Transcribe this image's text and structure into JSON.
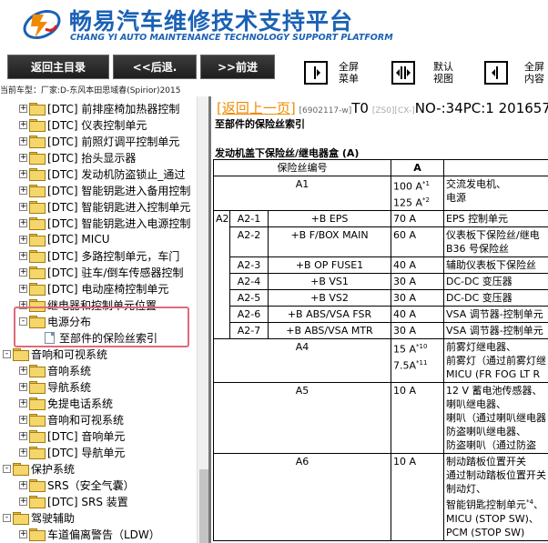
{
  "header": {
    "title": "畅易汽车维修技术支持平台",
    "subtitle": "CHANG YI AUTO MAINTENANCE TECHNOLOGY SUPPORT PLATFORM",
    "logo_color": "#1a61b5"
  },
  "toolbar": {
    "home": "返回主目录",
    "back": "<<后退.",
    "forward": ">>前进",
    "fullscreen_menu": [
      "全屏",
      "菜单"
    ],
    "default_view": [
      "默认",
      "视图"
    ],
    "fullscreen_content": [
      "全屏",
      "内容"
    ]
  },
  "path": "当前车型：厂家:D-东风本田思域春(Spirior)2015",
  "tree": [
    {
      "label": "[DTC] 前排座椅加热器控制",
      "indent": 1,
      "exp": "+",
      "type": "folder"
    },
    {
      "label": "[DTC] 仪表控制单元",
      "indent": 1,
      "exp": "+",
      "type": "folder"
    },
    {
      "label": "[DTC] 前照灯调平控制单元",
      "indent": 1,
      "exp": "+",
      "type": "folder"
    },
    {
      "label": "[DTC] 抬头显示器",
      "indent": 1,
      "exp": "+",
      "type": "folder"
    },
    {
      "label": "[DTC] 发动机防盗锁止_通过",
      "indent": 1,
      "exp": "+",
      "type": "folder"
    },
    {
      "label": "[DTC] 智能钥匙进入备用控制",
      "indent": 1,
      "exp": "+",
      "type": "folder"
    },
    {
      "label": "[DTC] 智能钥匙进入控制单元",
      "indent": 1,
      "exp": "+",
      "type": "folder"
    },
    {
      "label": "[DTC] 智能钥匙进入电源控制",
      "indent": 1,
      "exp": "+",
      "type": "folder"
    },
    {
      "label": "[DTC] MICU",
      "indent": 1,
      "exp": "+",
      "type": "folder"
    },
    {
      "label": "[DTC] 多路控制单元，车门",
      "indent": 1,
      "exp": "+",
      "type": "folder"
    },
    {
      "label": "[DTC] 驻车/倒车传感器控制",
      "indent": 1,
      "exp": "+",
      "type": "folder"
    },
    {
      "label": "[DTC] 电动座椅控制单元",
      "indent": 1,
      "exp": "+",
      "type": "folder"
    },
    {
      "label": "继电器和控制单元位置",
      "indent": 1,
      "exp": "+",
      "type": "folder"
    },
    {
      "label": "电源分布",
      "indent": 1,
      "exp": "-",
      "type": "folder"
    },
    {
      "label": "至部件的保险丝索引",
      "indent": 2,
      "exp": "",
      "type": "doc"
    },
    {
      "label": "音响和可视系统",
      "indent": 0,
      "exp": "-",
      "type": "folder"
    },
    {
      "label": "音响系统",
      "indent": 1,
      "exp": "+",
      "type": "folder"
    },
    {
      "label": "导航系统",
      "indent": 1,
      "exp": "+",
      "type": "folder"
    },
    {
      "label": "免提电话系统",
      "indent": 1,
      "exp": "+",
      "type": "folder"
    },
    {
      "label": "音响和可视系统",
      "indent": 1,
      "exp": "+",
      "type": "folder"
    },
    {
      "label": "[DTC] 音响单元",
      "indent": 1,
      "exp": "+",
      "type": "folder"
    },
    {
      "label": "[DTC] 导航单元",
      "indent": 1,
      "exp": "+",
      "type": "folder"
    },
    {
      "label": "保护系统",
      "indent": 0,
      "exp": "-",
      "type": "folder"
    },
    {
      "label": "SRS（安全气囊）",
      "indent": 1,
      "exp": "+",
      "type": "folder"
    },
    {
      "label": "[DTC] SRS 装置",
      "indent": 1,
      "exp": "+",
      "type": "folder"
    },
    {
      "label": "驾驶辅助",
      "indent": 0,
      "exp": "-",
      "type": "folder"
    },
    {
      "label": "车道偏离警告（LDW）",
      "indent": 1,
      "exp": "+",
      "type": "folder"
    }
  ],
  "content": {
    "back_link": "[返回上一页]",
    "code1": "[6902117-w]",
    "t0": "T0",
    "code2": "[ZS0]",
    "code3": "[CX-]",
    "doc_no": "NO-:34PC:1 201657",
    "heading1": "至部件的保险丝索引",
    "heading2": "发动机盖下保险丝/继电器盒 (A)",
    "col_fuse_no": "保险丝编号",
    "col_a": "A",
    "rows": [
      {
        "main": "A1",
        "sub": "",
        "circuit": "",
        "amp": [
          "100 A*1",
          "125 A*2"
        ],
        "desc": [
          "交流发电机、",
          "电源"
        ]
      },
      {
        "main": "",
        "sub": "A2-1",
        "circuit": "+B EPS",
        "amp": [
          "70 A"
        ],
        "desc": [
          "EPS 控制单元"
        ]
      },
      {
        "main": "",
        "sub": "A2-2",
        "circuit": "+B F/BOX MAIN",
        "amp": [
          "60 A"
        ],
        "desc": [
          "仪表板下保险丝/继电",
          "B36 号保险丝"
        ]
      },
      {
        "main": "",
        "sub": "A2-3",
        "circuit": "+B OP FUSE1",
        "amp": [
          "40 A"
        ],
        "desc": [
          "辅助仪表板下保险丝"
        ]
      },
      {
        "main": "",
        "sub": "A2-4",
        "circuit": "+B VS1",
        "amp": [
          "30 A"
        ],
        "desc": [
          "DC-DC 变压器"
        ]
      },
      {
        "main": "",
        "sub": "A2-5",
        "circuit": "+B VS2",
        "amp": [
          "30 A"
        ],
        "desc": [
          "DC-DC 变压器"
        ]
      },
      {
        "main": "",
        "sub": "A2-6",
        "circuit": "+B ABS/VSA FSR",
        "amp": [
          "40 A"
        ],
        "desc": [
          "VSA 调节器-控制单元"
        ]
      },
      {
        "main": "",
        "sub": "A2-7",
        "circuit": "+B ABS/VSA MTR",
        "amp": [
          "30 A"
        ],
        "desc": [
          "VSA 调节器-控制单元"
        ]
      },
      {
        "main": "A4",
        "sub": "",
        "circuit": "",
        "amp": [
          "15 A*10",
          "7.5A*11"
        ],
        "desc": [
          "前雾灯继电器、",
          "前雾灯（通过前雾灯继",
          "MICU (FR FOG LT R"
        ]
      },
      {
        "main": "A5",
        "sub": "",
        "circuit": "",
        "amp": [
          "10 A"
        ],
        "desc": [
          "12 V 蓄电池传感器、",
          "喇叭继电器、",
          "喇叭（通过喇叭继电器",
          "防盗喇叭继电器、",
          "防盗喇叭（通过防盗"
        ]
      },
      {
        "main": "A6",
        "sub": "",
        "circuit": "",
        "amp": [
          "10 A"
        ],
        "desc": [
          "制动踏板位置开关",
          "通过制动踏板位置开关",
          "制动灯、",
          "智能钥匙控制单元*4、",
          "MICU (STOP SW)、",
          "PCM (STOP SW)"
        ]
      }
    ],
    "a2_label": "A2"
  }
}
